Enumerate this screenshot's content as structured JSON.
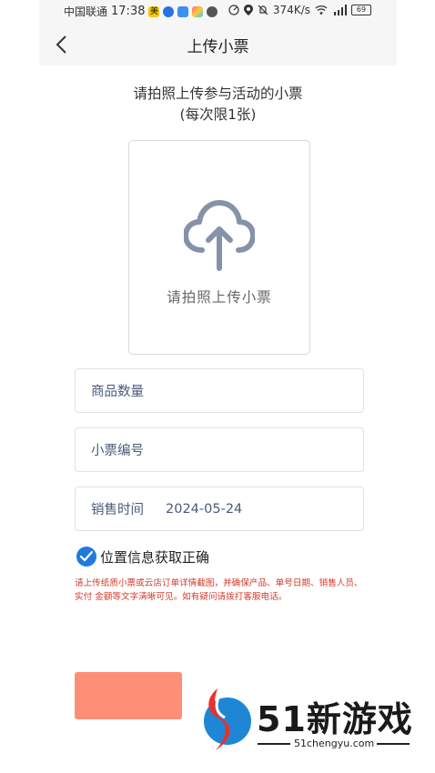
{
  "status_bar": {
    "carrier": "中国联通",
    "time": "17:38",
    "app_badge": "美",
    "speed": "374K/s",
    "battery": "69"
  },
  "header": {
    "title": "上传小票"
  },
  "instruction": {
    "line1": "请拍照上传参与活动的小票",
    "line2": "(每次限1张)"
  },
  "upload": {
    "label": "请拍照上传小票"
  },
  "form": {
    "quantity_label": "商品数量",
    "receipt_no_label": "小票编号",
    "sale_time_label": "销售时间",
    "sale_time_value": "2024-05-24"
  },
  "location_check": {
    "label": "位置信息获取正确",
    "checked": true
  },
  "notice": "请上传纸质小票或云店订单详情截图，并确保产品、单号日期、销售人员、实付 金额等文字清晰可见。如有疑问请拨打客服电话。",
  "colors": {
    "accent": "#1f7ae0",
    "notice": "#d23a2a",
    "submit": "#ff8e77"
  },
  "watermark": {
    "brand_num": "51",
    "brand_text": "新游戏",
    "url": "51chengyu.com"
  }
}
